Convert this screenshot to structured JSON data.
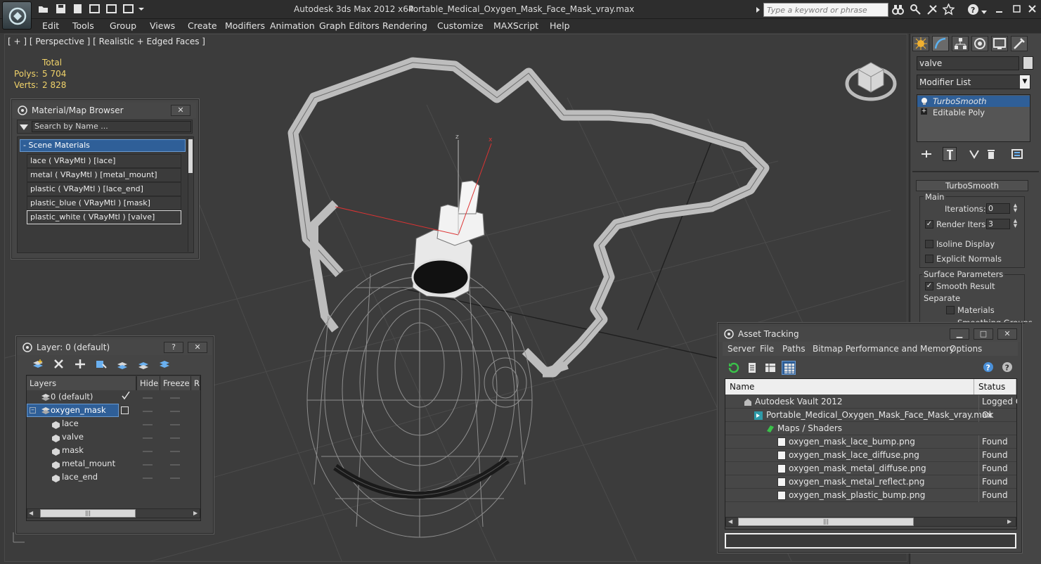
{
  "app": {
    "title": "Autodesk 3ds Max  2012 x64",
    "file": "Portable_Medical_Oxygen_Mask_Face_Mask_vray.max",
    "search_placeholder": "Type a keyword or phrase"
  },
  "menu": [
    "Edit",
    "Tools",
    "Group",
    "Views",
    "Create",
    "Modifiers",
    "Animation",
    "Graph Editors",
    "Rendering",
    "Customize",
    "MAXScript",
    "Help"
  ],
  "viewport": {
    "label": "[ + ] [ Perspective ] [ Realistic + Edged Faces ]",
    "stats": {
      "total_label": "Total",
      "polys_label": "Polys:",
      "polys": "5 704",
      "verts_label": "Verts:",
      "verts": "2 828"
    }
  },
  "command_panel": {
    "object_name": "valve",
    "modifier_list": "Modifier List",
    "stack": [
      "TurboSmooth",
      "Editable Poly"
    ],
    "rollout_title": "TurboSmooth",
    "main_label": "Main",
    "iterations_label": "Iterations:",
    "iterations": "0",
    "render_iters_label": "Render Iters:",
    "render_iters": "3",
    "isoline_label": "Isoline Display",
    "explicit_label": "Explicit Normals",
    "surface_label": "Surface Parameters",
    "smooth_label": "Smooth Result",
    "separate_label": "Separate",
    "materials_label": "Materials",
    "smoothing_label": "Smoothing Groups"
  },
  "material_browser": {
    "title": "Material/Map Browser",
    "search_placeholder": "Search by Name ...",
    "group": "- Scene Materials",
    "materials": [
      "lace  ( VRayMtl ) [lace]",
      "metal  ( VRayMtl ) [metal_mount]",
      "plastic  ( VRayMtl ) [lace_end]",
      "plastic_blue  ( VRayMtl ) [mask]",
      "plastic_white  ( VRayMtl ) [valve]"
    ]
  },
  "layer_manager": {
    "title": "Layer: 0 (default)",
    "columns": [
      "Layers",
      "Hide",
      "Freeze",
      "R"
    ],
    "layers": [
      "0 (default)",
      "oxygen_mask"
    ],
    "objects": [
      "lace",
      "valve",
      "mask",
      "metal_mount",
      "lace_end"
    ]
  },
  "asset_tracking": {
    "title": "Asset Tracking",
    "menu": [
      "Server",
      "File",
      "Paths",
      "Bitmap Performance and Memory",
      "Options"
    ],
    "columns": [
      "Name",
      "Status"
    ],
    "rows": [
      {
        "name": "Autodesk Vault 2012",
        "status": "Logged O"
      },
      {
        "name": "Portable_Medical_Oxygen_Mask_Face_Mask_vray.max",
        "status": "Ok"
      },
      {
        "name": "Maps / Shaders",
        "status": ""
      },
      {
        "name": "oxygen_mask_lace_bump.png",
        "status": "Found"
      },
      {
        "name": "oxygen_mask_lace_diffuse.png",
        "status": "Found"
      },
      {
        "name": "oxygen_mask_metal_diffuse.png",
        "status": "Found"
      },
      {
        "name": "oxygen_mask_metal_reflect.png",
        "status": "Found"
      },
      {
        "name": "oxygen_mask_plastic_bump.png",
        "status": "Found"
      }
    ]
  },
  "colors": {
    "selection_blue": "#2f5f98",
    "stat_yellow": "#f1d36a",
    "bg_dark": "#3c3c3c"
  }
}
